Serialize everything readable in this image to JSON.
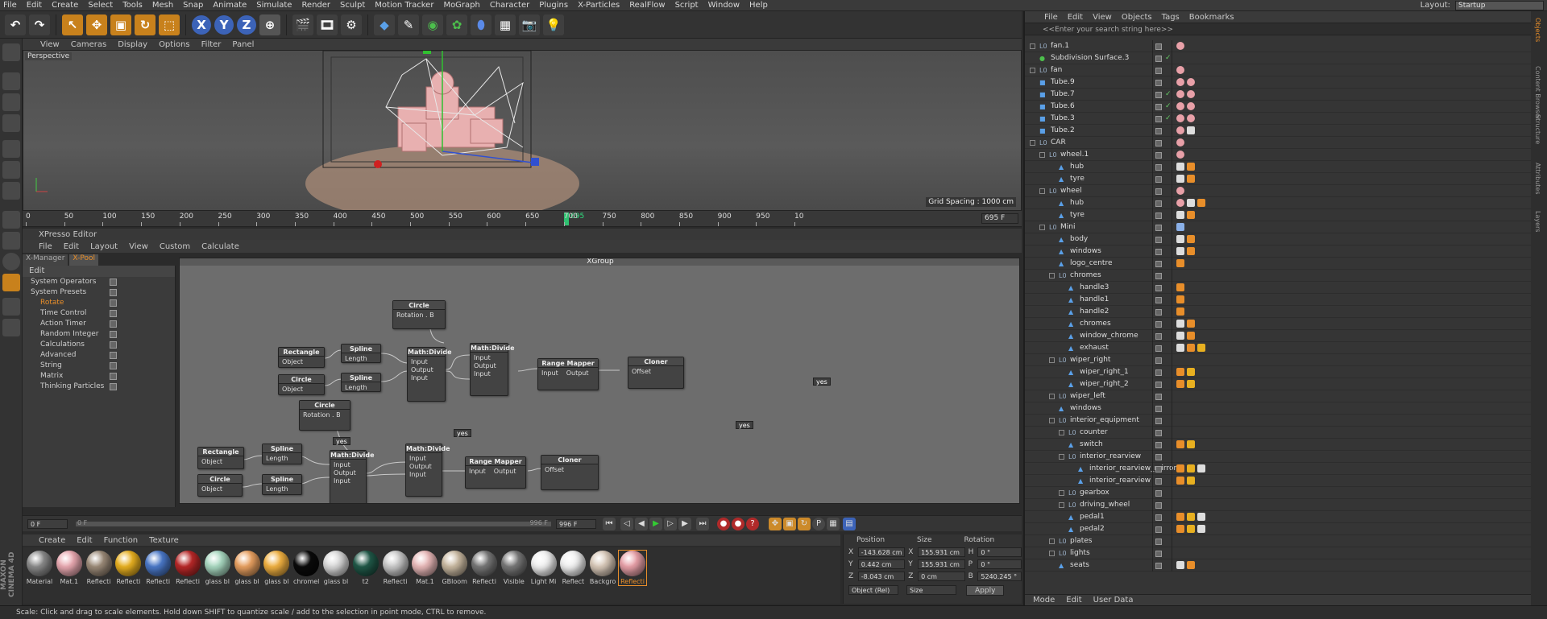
{
  "menubar": {
    "items": [
      "File",
      "Edit",
      "Create",
      "Select",
      "Tools",
      "Mesh",
      "Snap",
      "Animate",
      "Simulate",
      "Render",
      "Sculpt",
      "Motion Tracker",
      "MoGraph",
      "Character",
      "Plugins",
      "X-Particles",
      "RealFlow",
      "Script",
      "Window",
      "Help"
    ],
    "layout_label": "Layout:",
    "layout_value": "Startup"
  },
  "toolbar": {
    "icons": [
      "undo-icon",
      "redo-icon",
      "select-arrow-icon",
      "move-icon",
      "scale-icon",
      "rotate-icon",
      "live-selection-icon",
      "x-axis-icon",
      "y-axis-icon",
      "z-axis-icon",
      "world-coordinates-icon",
      "render-view-icon",
      "render-picture-viewer-icon",
      "render-settings-icon",
      "cube-icon",
      "spline-pen-icon",
      "subdivision-icon",
      "cloner-icon",
      "deformer-icon",
      "floor-icon",
      "camera-icon",
      "light-icon"
    ],
    "axis_x": "X",
    "axis_y": "Y",
    "axis_z": "Z"
  },
  "viewport": {
    "menu": [
      "View",
      "Cameras",
      "Display",
      "Options",
      "Filter",
      "Panel"
    ],
    "label": "Perspective",
    "grid_spacing": "Grid Spacing : 1000 cm"
  },
  "timeline": {
    "ticks": [
      "0",
      "50",
      "100",
      "150",
      "200",
      "250",
      "300",
      "350",
      "400",
      "450",
      "500",
      "550",
      "600",
      "650",
      "700",
      "750",
      "800",
      "850",
      "900",
      "950",
      "10"
    ],
    "current_marker": "695",
    "frame_field": "695 F"
  },
  "xpresso": {
    "title": "XPresso Editor",
    "menu": [
      "File",
      "Edit",
      "Layout",
      "View",
      "Custom",
      "Calculate"
    ],
    "tabs": [
      "X-Manager",
      "X-Pool"
    ],
    "pool_header": "Edit",
    "pool_items": [
      "System Operators",
      "System Presets",
      "Rotate",
      "Time Control",
      "Action Timer",
      "Random Integer",
      "Calculations",
      "Advanced",
      "String",
      "Matrix",
      "Thinking Particles"
    ],
    "group_title": "XGroup",
    "nodes": {
      "circle1": {
        "title": "Circle",
        "port": "Rotation . B"
      },
      "rect1": {
        "title": "Rectangle",
        "port": "Object"
      },
      "spline1": {
        "title": "Spline",
        "port": "Length"
      },
      "circle2": {
        "title": "Circle",
        "port": "Object"
      },
      "spline2": {
        "title": "Spline",
        "port": "Length"
      },
      "math1": {
        "title": "Math:Divide",
        "p1": "Input",
        "p2": "Output",
        "p3": "Input"
      },
      "math2": {
        "title": "Math:Divide",
        "p1": "Input",
        "p2": "Output",
        "p3": "Input"
      },
      "range1": {
        "title": "Range Mapper",
        "p1": "Input",
        "p2": "Output"
      },
      "cloner1": {
        "title": "Cloner",
        "port": "Offset"
      },
      "circle3": {
        "title": "Circle",
        "port": "Rotation . B"
      },
      "rect2": {
        "title": "Rectangle",
        "port": "Object"
      },
      "spline3": {
        "title": "Spline",
        "port": "Length"
      },
      "circle4": {
        "title": "Circle",
        "port": "Object"
      },
      "spline4": {
        "title": "Spline",
        "port": "Length"
      },
      "math3": {
        "title": "Math:Divide",
        "p1": "Input",
        "p2": "Output",
        "p3": "Input"
      },
      "math4": {
        "title": "Math:Divide",
        "p1": "Input",
        "p2": "Output",
        "p3": "Input"
      },
      "range2": {
        "title": "Range Mapper",
        "p1": "Input",
        "p2": "Output"
      },
      "cloner2": {
        "title": "Cloner",
        "port": "Offset"
      },
      "yes": "yes"
    }
  },
  "transport": {
    "start_frame": "0 F",
    "range_start": "0 F",
    "range_end": "996 F",
    "end_frame": "996 F"
  },
  "materials": {
    "menu": [
      "Create",
      "Edit",
      "Function",
      "Texture"
    ],
    "items": [
      {
        "name": "Material",
        "color": "#8a8a8a"
      },
      {
        "name": "Mat.1",
        "color": "#e8a8b0"
      },
      {
        "name": "Reflecti",
        "color": "#9b8a78"
      },
      {
        "name": "Reflecti",
        "color": "#e8b020"
      },
      {
        "name": "Reflecti",
        "color": "#4a78c8"
      },
      {
        "name": "Reflecti",
        "color": "#b82828"
      },
      {
        "name": "glass bl",
        "color": "#a8d8c0"
      },
      {
        "name": "glass bl",
        "color": "#e8a060"
      },
      {
        "name": "glass bl",
        "color": "#f0b040"
      },
      {
        "name": "chromel",
        "color": "#0a0a0a"
      },
      {
        "name": "glass bl",
        "color": "#d8d8d8"
      },
      {
        "name": "t2",
        "color": "#205848"
      },
      {
        "name": "Reflecti",
        "color": "#c8c8c8"
      },
      {
        "name": "Mat.1",
        "color": "#e8b8b8"
      },
      {
        "name": "GBloom",
        "color": "#c8b8a0"
      },
      {
        "name": "Reflecti",
        "color": "#777777"
      },
      {
        "name": "Visible",
        "color": "#777777"
      },
      {
        "name": "Light Mi",
        "color": "#f0f0f0"
      },
      {
        "name": "Reflect",
        "color": "#f0f0f0"
      },
      {
        "name": "Backgro",
        "color": "#d8c8b8"
      },
      {
        "name": "Reflecti",
        "color": "#e8a0a8"
      }
    ]
  },
  "coordinates": {
    "headers": [
      "Position",
      "Size",
      "Rotation"
    ],
    "rows": [
      {
        "axis": "X",
        "pos": "-143.628 cm",
        "size_axis": "X",
        "size": "155.931 cm",
        "rot_axis": "H",
        "rot": "0 °"
      },
      {
        "axis": "Y",
        "pos": "0.442 cm",
        "size_axis": "Y",
        "size": "155.931 cm",
        "rot_axis": "P",
        "rot": "0 °"
      },
      {
        "axis": "Z",
        "pos": "-8.043 cm",
        "size_axis": "Z",
        "size": "0 cm",
        "rot_axis": "B",
        "rot": "5240.245 °"
      }
    ],
    "mode1": "Object (Rel)",
    "mode2": "Size",
    "apply": "Apply"
  },
  "status": "Scale: Click and drag to scale elements. Hold down SHIFT to quantize scale / add to the selection in point mode, CTRL to remove.",
  "objects": {
    "menu": [
      "File",
      "Edit",
      "View",
      "Objects",
      "Tags",
      "Bookmarks"
    ],
    "search_placeholder": "<<Enter your search string here>>",
    "rows": [
      {
        "name": "fan.1",
        "indent": 0,
        "type": "null"
      },
      {
        "name": "Subdivision Surface.3",
        "indent": 0,
        "type": "subd"
      },
      {
        "name": "fan",
        "indent": 0,
        "type": "null"
      },
      {
        "name": "Tube.9",
        "indent": 0,
        "type": "obj"
      },
      {
        "name": "Tube.7",
        "indent": 0,
        "type": "obj"
      },
      {
        "name": "Tube.6",
        "indent": 0,
        "type": "obj"
      },
      {
        "name": "Tube.3",
        "indent": 0,
        "type": "obj"
      },
      {
        "name": "Tube.2",
        "indent": 0,
        "type": "obj"
      },
      {
        "name": "CAR",
        "indent": 0,
        "type": "null"
      },
      {
        "name": "wheel.1",
        "indent": 1,
        "type": "null"
      },
      {
        "name": "hub",
        "indent": 2,
        "type": "poly"
      },
      {
        "name": "tyre",
        "indent": 2,
        "type": "poly"
      },
      {
        "name": "wheel",
        "indent": 1,
        "type": "null"
      },
      {
        "name": "hub",
        "indent": 2,
        "type": "poly"
      },
      {
        "name": "tyre",
        "indent": 2,
        "type": "poly"
      },
      {
        "name": "Mini",
        "indent": 1,
        "type": "null"
      },
      {
        "name": "body",
        "indent": 2,
        "type": "poly"
      },
      {
        "name": "windows",
        "indent": 2,
        "type": "poly"
      },
      {
        "name": "logo_centre",
        "indent": 2,
        "type": "poly"
      },
      {
        "name": "chromes",
        "indent": 2,
        "type": "null"
      },
      {
        "name": "handle3",
        "indent": 3,
        "type": "poly"
      },
      {
        "name": "handle1",
        "indent": 3,
        "type": "poly"
      },
      {
        "name": "handle2",
        "indent": 3,
        "type": "poly"
      },
      {
        "name": "chromes",
        "indent": 3,
        "type": "poly"
      },
      {
        "name": "window_chrome",
        "indent": 3,
        "type": "poly"
      },
      {
        "name": "exhaust",
        "indent": 3,
        "type": "poly"
      },
      {
        "name": "wiper_right",
        "indent": 2,
        "type": "null"
      },
      {
        "name": "wiper_right_1",
        "indent": 3,
        "type": "poly"
      },
      {
        "name": "wiper_right_2",
        "indent": 3,
        "type": "poly"
      },
      {
        "name": "wiper_left",
        "indent": 2,
        "type": "null"
      },
      {
        "name": "windows",
        "indent": 2,
        "type": "poly"
      },
      {
        "name": "interior_equipment",
        "indent": 2,
        "type": "null"
      },
      {
        "name": "counter",
        "indent": 3,
        "type": "null"
      },
      {
        "name": "switch",
        "indent": 3,
        "type": "poly"
      },
      {
        "name": "interior_rearview",
        "indent": 3,
        "type": "null"
      },
      {
        "name": "interior_rearview_mirror",
        "indent": 4,
        "type": "poly"
      },
      {
        "name": "interior_rearview",
        "indent": 4,
        "type": "poly"
      },
      {
        "name": "gearbox",
        "indent": 3,
        "type": "null"
      },
      {
        "name": "driving_wheel",
        "indent": 3,
        "type": "null"
      },
      {
        "name": "pedal1",
        "indent": 3,
        "type": "poly"
      },
      {
        "name": "pedal2",
        "indent": 3,
        "type": "poly"
      },
      {
        "name": "plates",
        "indent": 2,
        "type": "null"
      },
      {
        "name": "lights",
        "indent": 2,
        "type": "null"
      },
      {
        "name": "seats",
        "indent": 2,
        "type": "poly"
      }
    ],
    "bottom_menu": [
      "Mode",
      "Edit",
      "User Data"
    ]
  },
  "right_tabs": [
    "Objects",
    "Content Browser",
    "Structure",
    "Attributes",
    "Layers"
  ],
  "colors": {
    "accent": "#e88e2a",
    "selected_blue": "#3c63b8"
  }
}
